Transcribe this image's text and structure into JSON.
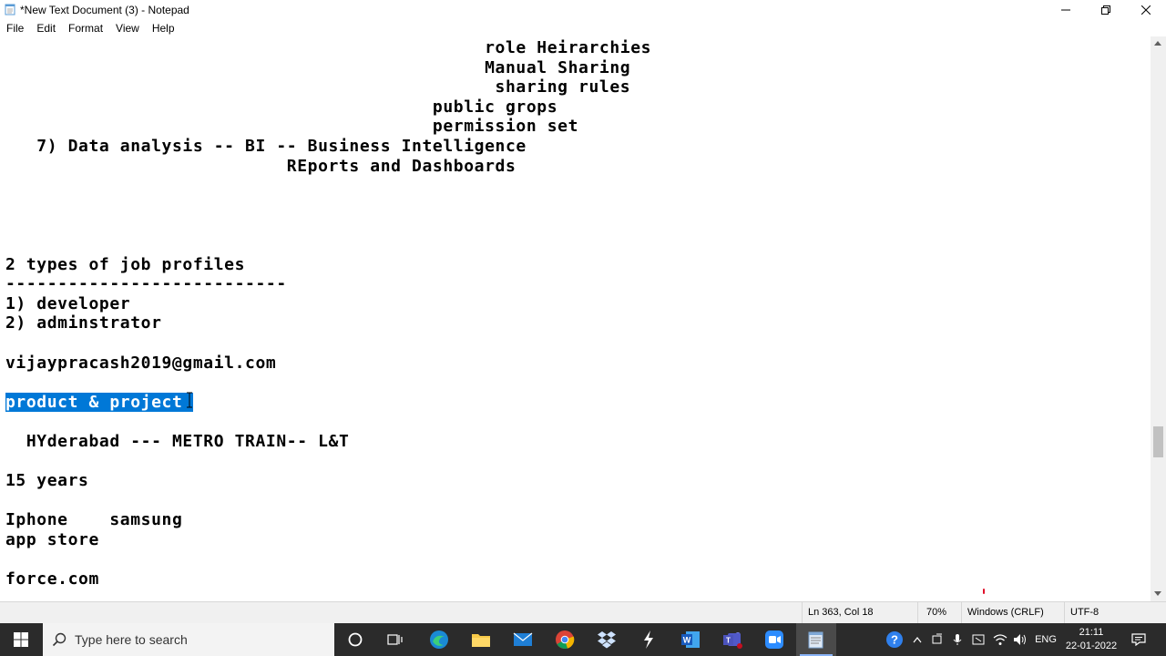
{
  "window": {
    "title": "*New Text Document (3) - Notepad",
    "controls": {
      "minimize": "minimize",
      "maximize": "restore",
      "close": "close"
    }
  },
  "menu": [
    "File",
    "Edit",
    "Format",
    "View",
    "Help"
  ],
  "editor": {
    "lines": [
      "                                              role Heirarchies",
      "                                              Manual Sharing",
      "                                               sharing rules",
      "                                         public grops",
      "                                         permission set",
      "   7) Data analysis -- BI -- Business Intelligence",
      "                           REports and Dashboards",
      "",
      "",
      "",
      "",
      "2 types of job profiles",
      "---------------------------",
      "1) developer",
      "2) adminstrator",
      "",
      "vijaypracash2019@gmail.com",
      "",
      "product & project ",
      "",
      "  HYderabad --- METRO TRAIN-- L&T",
      "",
      "15 years",
      "",
      "Iphone    samsung",
      "app store",
      "",
      "force.com"
    ],
    "selected_line_index": 18
  },
  "status": {
    "position": "Ln 363, Col 18",
    "zoom": "70%",
    "line_ending": "Windows (CRLF)",
    "encoding": "UTF-8"
  },
  "taskbar": {
    "search_placeholder": "Type here to search",
    "apps": [
      "cortana",
      "task-view",
      "edge",
      "file-explorer",
      "mail",
      "chrome",
      "dropbox",
      "app",
      "word",
      "teams",
      "zoom",
      "notepad"
    ],
    "tray": {
      "language": "ENG",
      "time": "21:11",
      "date": "22-01-2022"
    }
  }
}
